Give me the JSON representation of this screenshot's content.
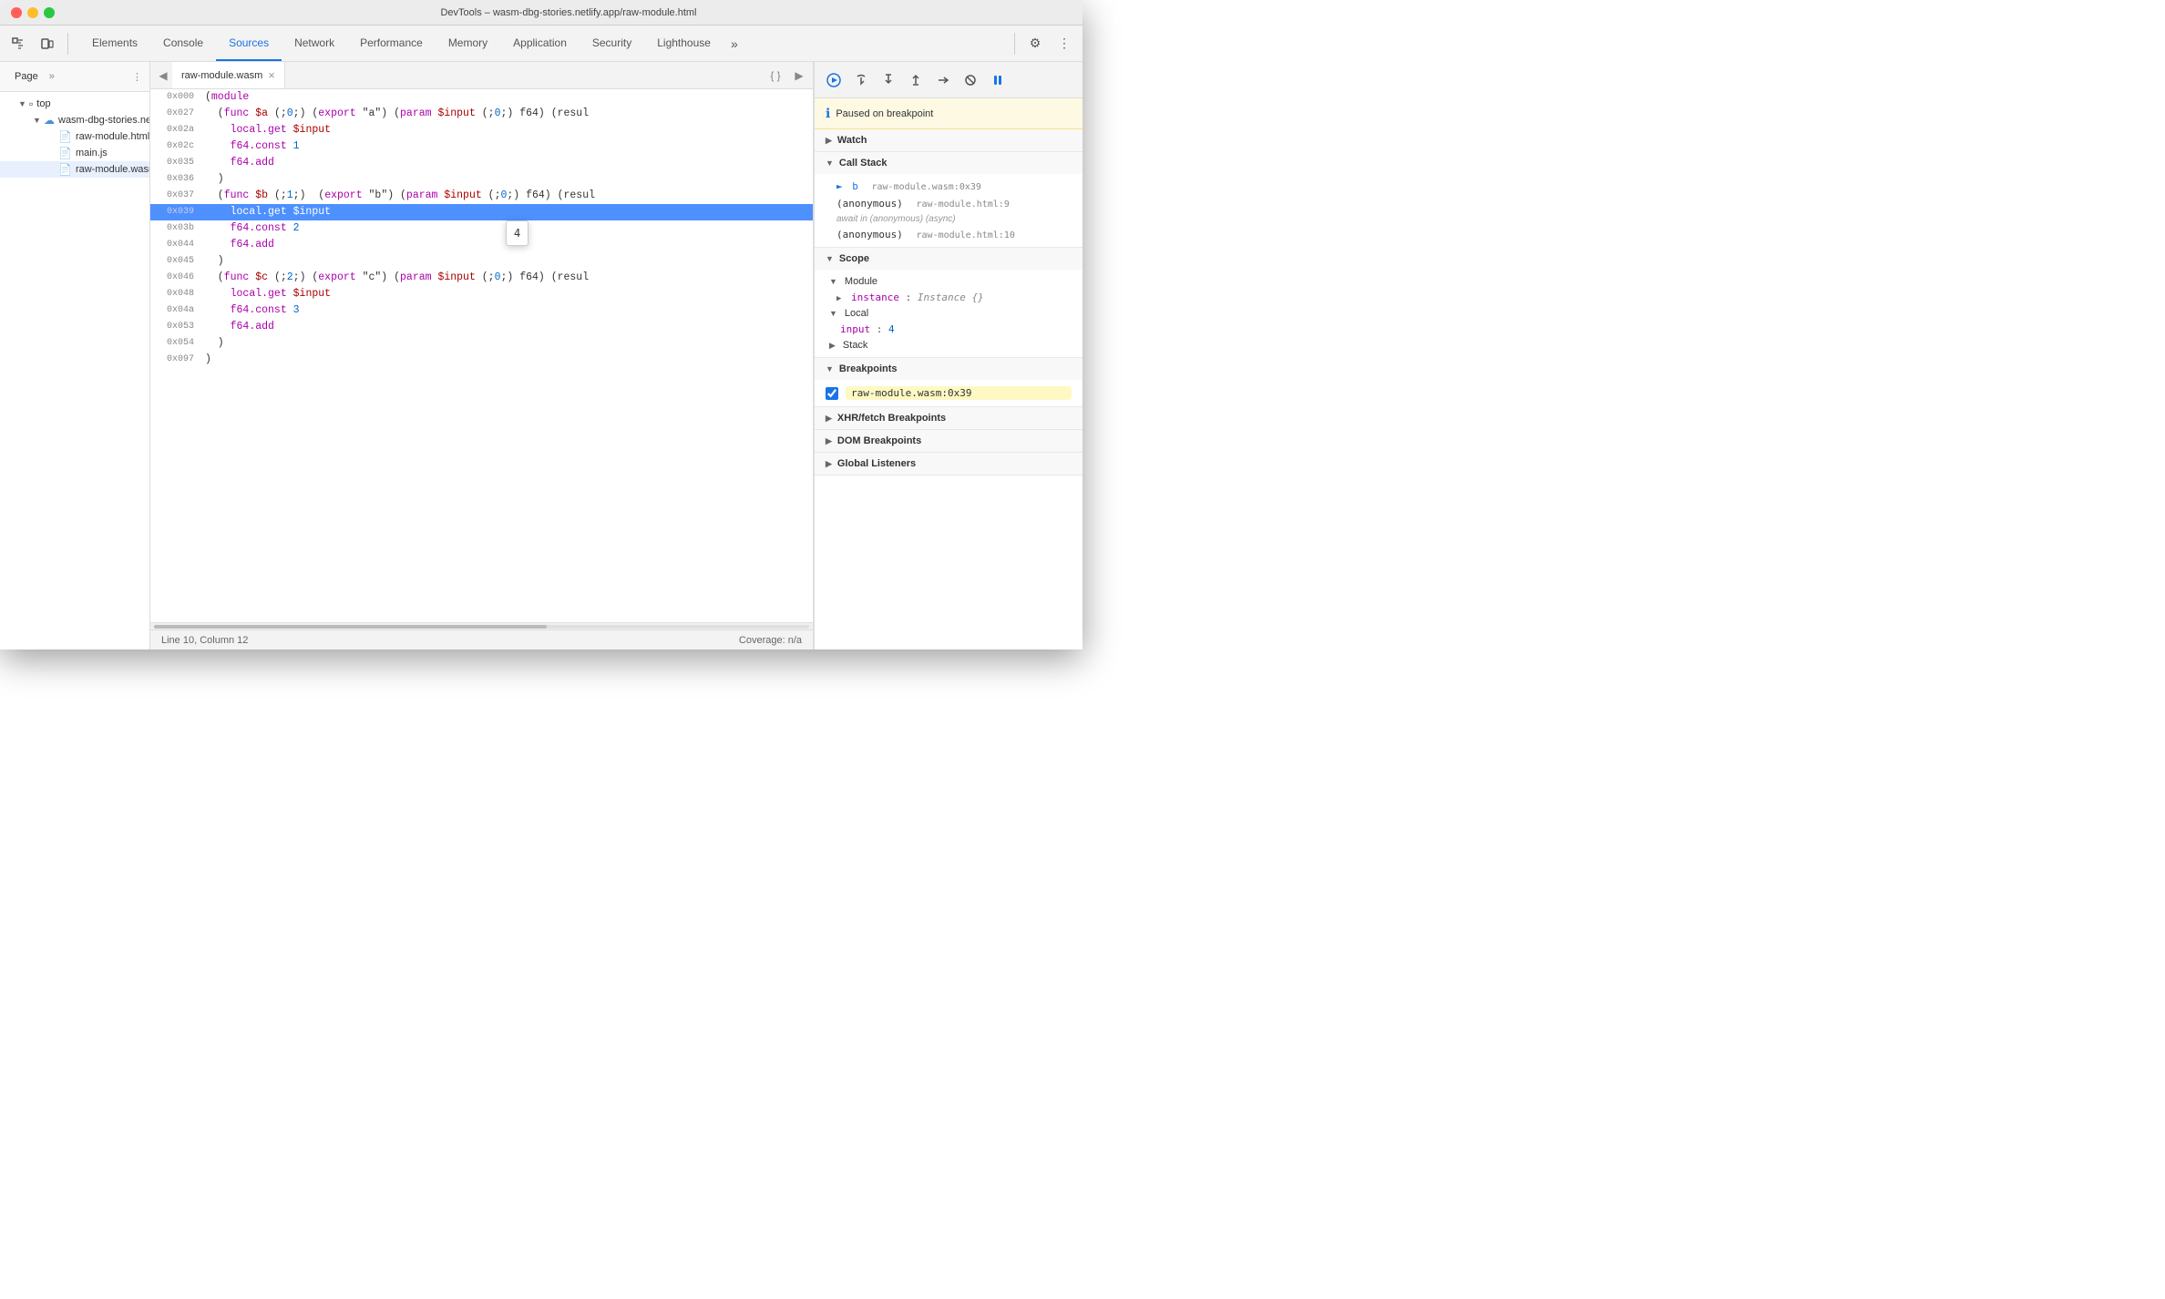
{
  "titleBar": {
    "title": "DevTools – wasm-dbg-stories.netlify.app/raw-module.html"
  },
  "tabs": [
    {
      "id": "elements",
      "label": "Elements",
      "active": false
    },
    {
      "id": "console",
      "label": "Console",
      "active": false
    },
    {
      "id": "sources",
      "label": "Sources",
      "active": true
    },
    {
      "id": "network",
      "label": "Network",
      "active": false
    },
    {
      "id": "performance",
      "label": "Performance",
      "active": false
    },
    {
      "id": "memory",
      "label": "Memory",
      "active": false
    },
    {
      "id": "application",
      "label": "Application",
      "active": false
    },
    {
      "id": "security",
      "label": "Security",
      "active": false
    },
    {
      "id": "lighthouse",
      "label": "Lighthouse",
      "active": false
    }
  ],
  "filePanel": {
    "tabLabel": "Page",
    "tree": [
      {
        "id": "top",
        "label": "top",
        "type": "folder",
        "expanded": true,
        "depth": 0
      },
      {
        "id": "origin",
        "label": "wasm-dbg-stories.netlify",
        "type": "cloud-folder",
        "expanded": true,
        "depth": 1
      },
      {
        "id": "raw-module-html",
        "label": "raw-module.html",
        "type": "file-html",
        "depth": 2
      },
      {
        "id": "main-js",
        "label": "main.js",
        "type": "file-js",
        "depth": 2
      },
      {
        "id": "raw-module-wasm",
        "label": "raw-module.wasm",
        "type": "file-wasm",
        "depth": 2
      }
    ]
  },
  "editor": {
    "tabName": "raw-module.wasm",
    "lines": [
      {
        "addr": "0x000",
        "content": "(module",
        "highlight": false
      },
      {
        "addr": "0x027",
        "content": "  (func $a (;0;) (export \"a\") (param $input (;0;) f64) (resul",
        "highlight": false
      },
      {
        "addr": "0x02a",
        "content": "    local.get $input",
        "highlight": false
      },
      {
        "addr": "0x02c",
        "content": "    f64.const 1",
        "highlight": false
      },
      {
        "addr": "0x035",
        "content": "    f64.add",
        "highlight": false
      },
      {
        "addr": "0x036",
        "content": "  )",
        "highlight": false
      },
      {
        "addr": "0x037",
        "content": "  (func $b (;1;)  (export \"b\") (param $input (;0;) f64) (resul",
        "highlight": false
      },
      {
        "addr": "0x039",
        "content": "    local.get $input",
        "highlight": true
      },
      {
        "addr": "0x03b",
        "content": "    f64.const 2",
        "highlight": false
      },
      {
        "addr": "0x044",
        "content": "    f64.add",
        "highlight": false
      },
      {
        "addr": "0x045",
        "content": "  )",
        "highlight": false
      },
      {
        "addr": "0x046",
        "content": "  (func $c (;2;) (export \"c\") (param $input (;0;) f64) (resul",
        "highlight": false
      },
      {
        "addr": "0x048",
        "content": "    local.get $input",
        "highlight": false
      },
      {
        "addr": "0x04a",
        "content": "    f64.const 3",
        "highlight": false
      },
      {
        "addr": "0x053",
        "content": "    f64.add",
        "highlight": false
      },
      {
        "addr": "0x054",
        "content": "  )",
        "highlight": false
      },
      {
        "addr": "0x097",
        "content": ")",
        "highlight": false
      }
    ],
    "tooltip": {
      "text": "4",
      "visible": true
    },
    "statusLine": "Line 10, Column 12",
    "statusCoverage": "Coverage: n/a"
  },
  "debugPanel": {
    "pausedMessage": "Paused on breakpoint",
    "sections": {
      "watch": {
        "label": "Watch",
        "expanded": false
      },
      "callStack": {
        "label": "Call Stack",
        "expanded": true,
        "items": [
          {
            "fn": "b",
            "loc": "raw-module.wasm:0x39",
            "current": true
          },
          {
            "fn": "(anonymous)",
            "loc": "raw-module.html:9",
            "current": false
          },
          {
            "async": true,
            "label": "await in (anonymous) (async)"
          },
          {
            "fn": "(anonymous)",
            "loc": "raw-module.html:10",
            "current": false
          }
        ]
      },
      "scope": {
        "label": "Scope",
        "expanded": true,
        "groups": [
          {
            "name": "Module",
            "items": [
              {
                "key": "instance",
                "value": "Instance {}"
              }
            ]
          },
          {
            "name": "Local",
            "items": [
              {
                "key": "input",
                "value": "4"
              }
            ]
          },
          {
            "name": "Stack",
            "collapsed": true
          }
        ]
      },
      "breakpoints": {
        "label": "Breakpoints",
        "expanded": true,
        "items": [
          {
            "label": "raw-module.wasm:0x39",
            "checked": true
          }
        ]
      },
      "xhrBreakpoints": {
        "label": "XHR/fetch Breakpoints",
        "expanded": false
      },
      "domBreakpoints": {
        "label": "DOM Breakpoints",
        "expanded": false
      },
      "globalListeners": {
        "label": "Global Listeners",
        "expanded": false
      }
    }
  }
}
